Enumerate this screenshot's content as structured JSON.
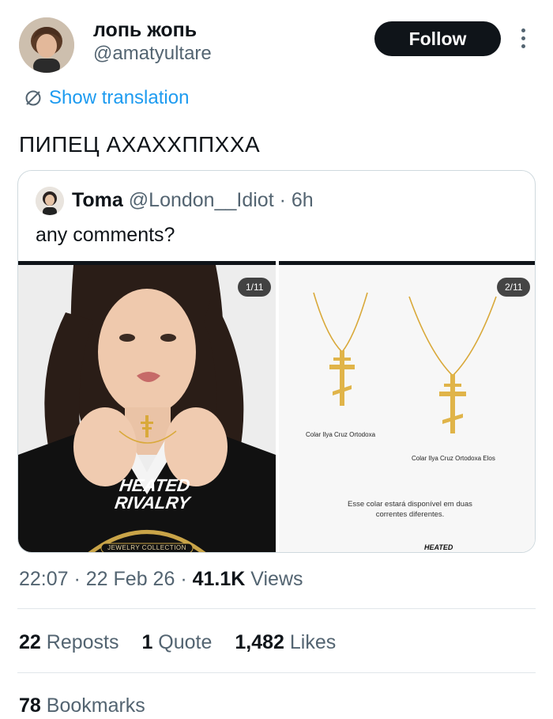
{
  "author": {
    "name": "лопь жопь",
    "handle": "@amatyultare",
    "avatar_icon": "user-avatar"
  },
  "follow_label": "Follow",
  "show_translation": "Show translation",
  "tweet_text": "ПИПЕЦ АХАХХППХХА",
  "quote": {
    "name": "Toma",
    "handle": "@London__Idiot",
    "separator": "·",
    "time": "6h",
    "text": "any comments?",
    "media": [
      {
        "counter": "1/11",
        "shirt_text_line1": "HEATED",
        "shirt_text_line2": "RIVALRY",
        "collection_label": "JEWELRY COLLECTION"
      },
      {
        "counter": "2/11",
        "caption_1": "Colar Ilya Cruz Ortodoxa",
        "caption_2": "Colar Ilya Cruz Ortodoxa Elos",
        "description": "Esse colar estará disponível em duas correntes diferentes.",
        "footer_logo": "HEATED"
      }
    ]
  },
  "timestamp": {
    "time": "22:07",
    "dot1": " · ",
    "date": "22 Feb 26",
    "dot2": " · ",
    "views_count": "41.1K",
    "views_label": " Views"
  },
  "stats": {
    "reposts_count": "22",
    "reposts_label": "Reposts",
    "quotes_count": "1",
    "quotes_label": "Quote",
    "likes_count": "1,482",
    "likes_label": "Likes",
    "bookmarks_count": "78",
    "bookmarks_label": "Bookmarks"
  },
  "colors": {
    "accent": "#1d9bf0",
    "text_primary": "#0f1419",
    "text_secondary": "#536471",
    "gold": "#d9a93a"
  }
}
